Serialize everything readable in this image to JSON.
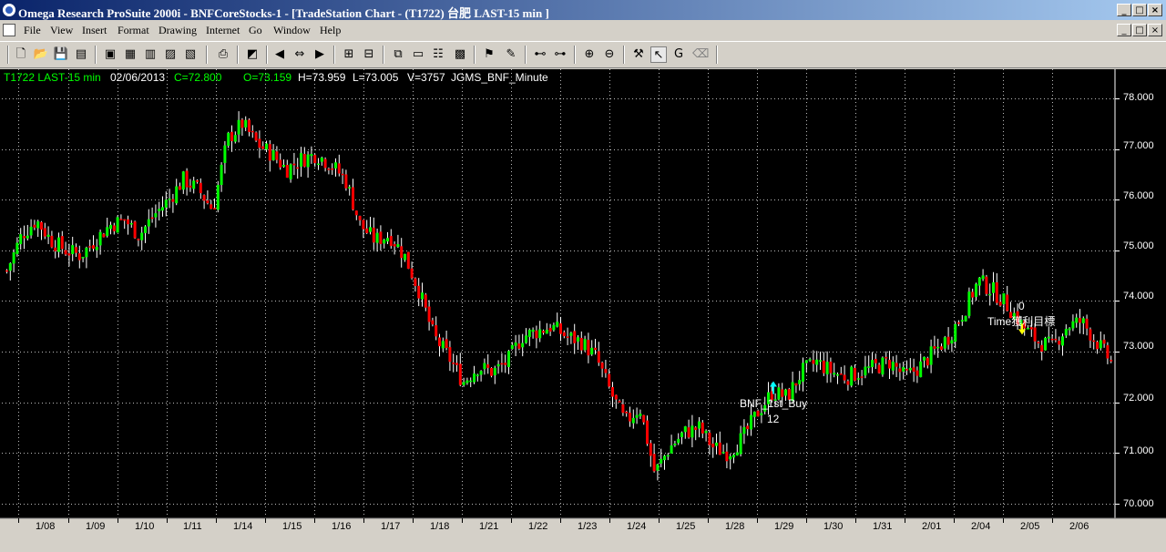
{
  "window": {
    "title": "Omega Research ProSuite 2000i - BNFCoreStocks-1 - [TradeStation Chart - (T1722) 台肥 LAST-15 min ]",
    "controls": [
      "_",
      "□",
      "×"
    ]
  },
  "menu": [
    "File",
    "View",
    "Insert",
    "Format",
    "Drawing",
    "Internet",
    "Go",
    "Window",
    "Help"
  ],
  "header": {
    "symbol": "T1722 LAST-15 min",
    "date": "02/06/2013",
    "close": "C=72.800",
    "open": "O=73.159",
    "high": "H=73.959",
    "low": "L=73.005",
    "volume": "V=3757",
    "indicator": "JGMS_BNF_Minute"
  },
  "colors": {
    "up": "#00ff00",
    "down": "#ff0000",
    "wick": "#ffffff",
    "header_green": "#00ff00",
    "header_white": "#ffffff",
    "buy_arrow": "#00ffff",
    "sell_arrow": "#ffff00"
  },
  "y_axis_labels": [
    "78.000",
    "77.000",
    "76.000",
    "75.000",
    "74.000",
    "73.000",
    "72.000",
    "71.000",
    "70.000"
  ],
  "x_axis_labels": [
    "1/08",
    "1/09",
    "1/10",
    "1/11",
    "1/14",
    "1/15",
    "1/16",
    "1/17",
    "1/18",
    "1/21",
    "1/22",
    "1/23",
    "1/24",
    "1/25",
    "1/28",
    "1/29",
    "1/30",
    "1/31",
    "2/01",
    "2/04",
    "2/05",
    "2/06"
  ],
  "annotations": {
    "buy_label": "BNF_1st_Buy",
    "buy_qty": "12",
    "sell_qty": "0",
    "sell_label": "Time獲利目標"
  },
  "chart_data": {
    "type": "candlestick",
    "symbol": "T1722",
    "interval": "15 min",
    "ylim": [
      69.8,
      78.2
    ],
    "grid": true,
    "days": [
      "1/08",
      "1/09",
      "1/10",
      "1/11",
      "1/14",
      "1/15",
      "1/16",
      "1/17",
      "1/18",
      "1/21",
      "1/22",
      "1/23",
      "1/24",
      "1/25",
      "1/28",
      "1/29",
      "1/30",
      "1/31",
      "2/01",
      "2/04",
      "2/05",
      "2/06"
    ],
    "close_path": [
      74.6,
      75.3,
      75.6,
      75.2,
      75.0,
      74.9,
      75.2,
      75.5,
      75.6,
      75.3,
      75.7,
      76.0,
      76.4,
      76.2,
      75.8,
      77.2,
      77.5,
      77.1,
      76.9,
      76.6,
      76.8,
      76.9,
      76.7,
      76.4,
      75.5,
      75.2,
      75.3,
      74.9,
      74.2,
      73.3,
      72.9,
      72.4,
      72.7,
      72.6,
      72.8,
      73.3,
      73.4,
      73.5,
      73.3,
      73.2,
      72.9,
      72.2,
      71.6,
      71.9,
      70.6,
      71.1,
      71.4,
      71.5,
      71.1,
      71.0,
      71.3,
      71.8,
      72.2,
      72.1,
      72.6,
      72.8,
      72.6,
      72.5,
      72.6,
      72.7,
      72.8,
      72.5,
      72.7,
      73.0,
      73.3,
      73.8,
      74.4,
      74.2,
      73.9,
      73.5,
      73.2,
      73.1,
      73.5,
      73.6,
      73.2,
      72.8
    ],
    "signals": [
      {
        "type": "buy",
        "label": "BNF_1st_Buy",
        "qty": "12",
        "day": "1/29",
        "price": 72.2
      },
      {
        "type": "sell",
        "label": "Time獲利目標",
        "qty": "0",
        "day": "2/05",
        "price": 73.3
      }
    ]
  }
}
